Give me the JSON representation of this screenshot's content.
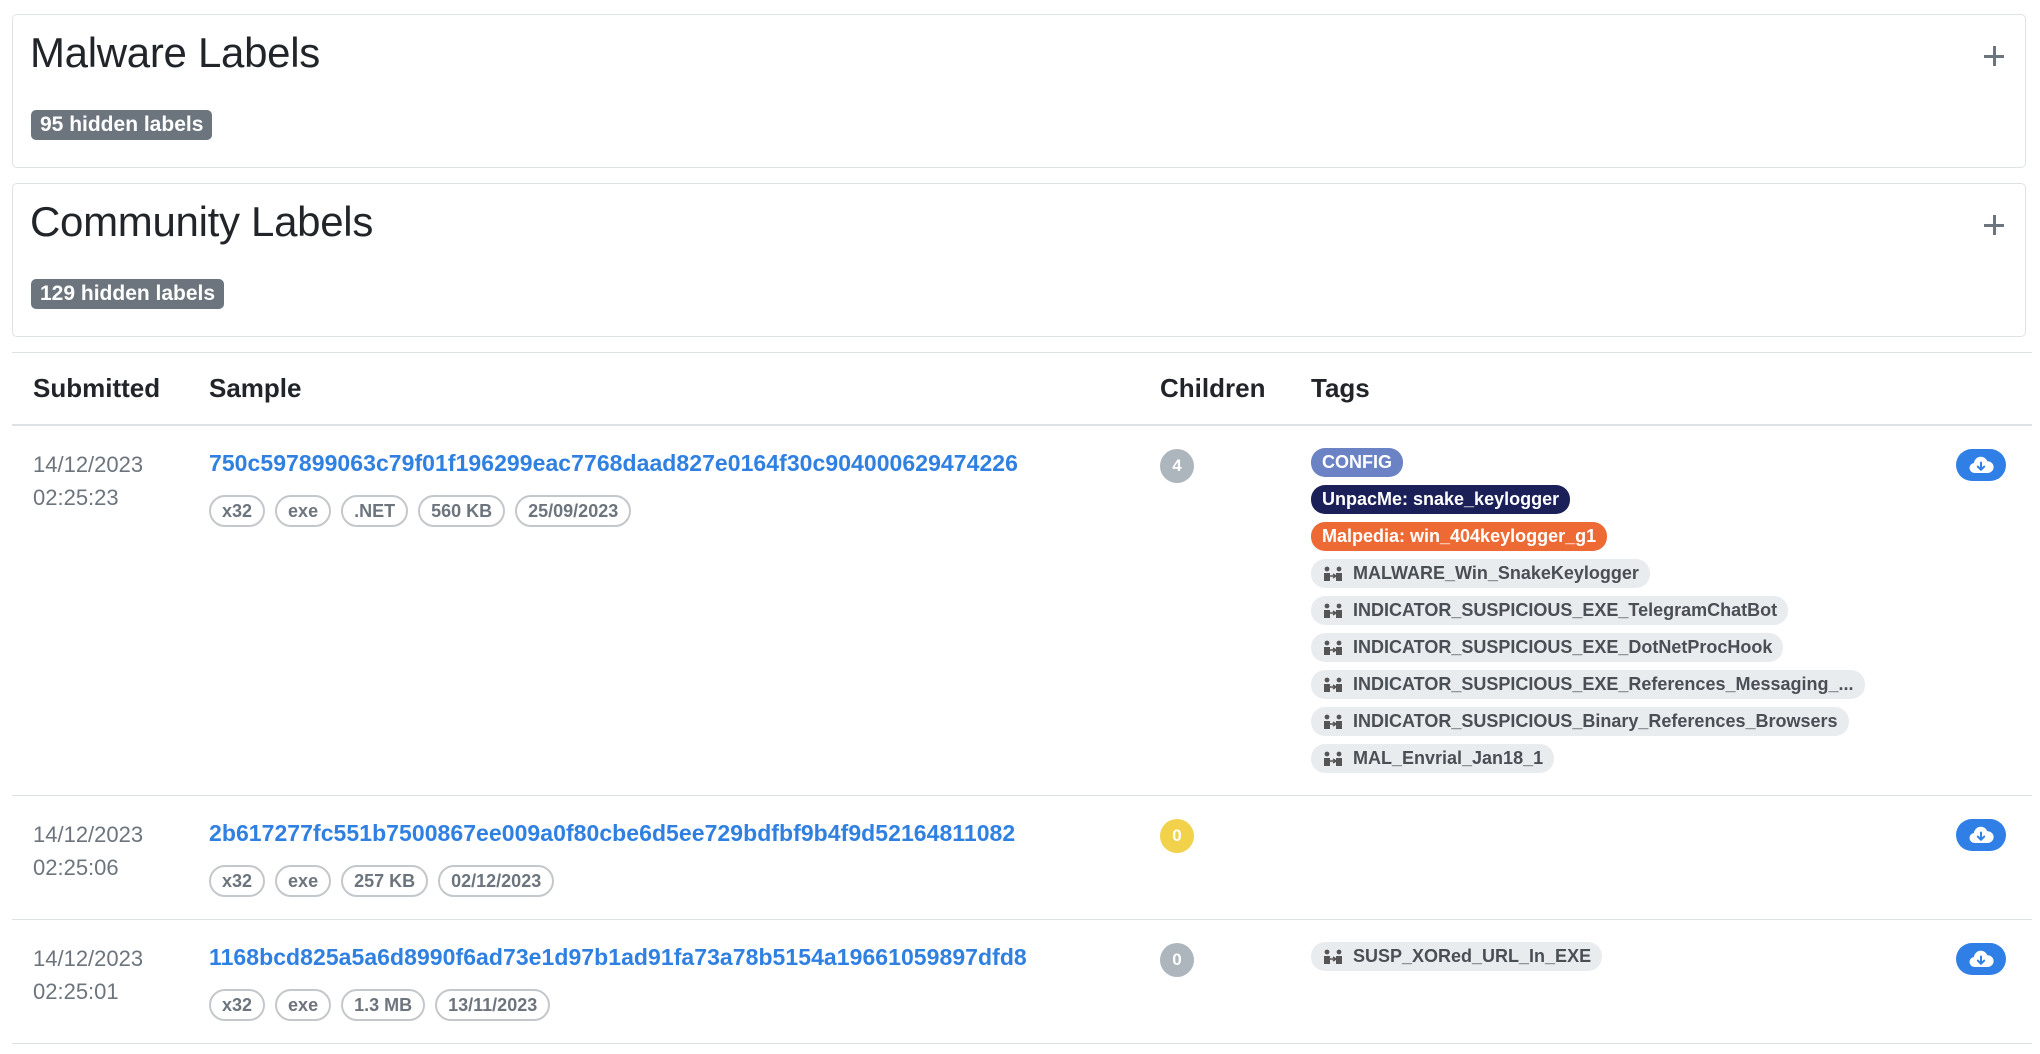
{
  "malware_card": {
    "title": "Malware Labels",
    "hidden_badge": "95 hidden labels",
    "expand_icon": "plus-icon"
  },
  "community_card": {
    "title": "Community Labels",
    "hidden_badge": "129 hidden labels",
    "expand_icon": "plus-icon"
  },
  "table": {
    "columns": [
      "Submitted",
      "Sample",
      "Children",
      "Tags"
    ],
    "rows": [
      {
        "date": "14/12/2023",
        "time": "02:25:23",
        "hash": "750c597899063c79f01f196299eac7768daad827e0164f30c904000629474226",
        "pills": [
          "x32",
          "exe",
          ".NET",
          "560 KB",
          "25/09/2023"
        ],
        "children": "4",
        "tags": {
          "config": "CONFIG",
          "unpacme": "UnpacMe: snake_keylogger",
          "malpedia": "Malpedia: win_404keylogger_g1",
          "yara": [
            "MALWARE_Win_SnakeKeylogger",
            "INDICATOR_SUSPICIOUS_EXE_TelegramChatBot",
            "INDICATOR_SUSPICIOUS_EXE_DotNetProcHook",
            "INDICATOR_SUSPICIOUS_EXE_References_Messaging_...",
            "INDICATOR_SUSPICIOUS_Binary_References_Browsers",
            "MAL_Envrial_Jan18_1"
          ]
        }
      },
      {
        "date": "14/12/2023",
        "time": "02:25:06",
        "hash": "2b617277fc551b7500867ee009a0f80cbe6d5ee729bdfbf9b4f9d52164811082",
        "pills": [
          "x32",
          "exe",
          "257 KB",
          "02/12/2023"
        ],
        "children": "0"
      },
      {
        "date": "14/12/2023",
        "time": "02:25:01",
        "hash": "1168bcd825a5a6d8990f6ad73e1d97b1ad91fa73a78b5154a19661059897dfd8",
        "pills": [
          "x32",
          "exe",
          "1.3 MB",
          "13/11/2023"
        ],
        "children": "0",
        "tags": {
          "yara": [
            "SUSP_XORed_URL_In_EXE"
          ]
        }
      }
    ]
  },
  "icons": {
    "yara_rule": "people-arrows-icon",
    "download": "cloud-download-icon"
  },
  "colors": {
    "link": "#2f80e0",
    "config": "#6b83c4",
    "unpacme": "#1b2058",
    "malpedia": "#ee6a34",
    "download": "#2f7fe6",
    "count_zero_yellow": "#f2d24b"
  }
}
